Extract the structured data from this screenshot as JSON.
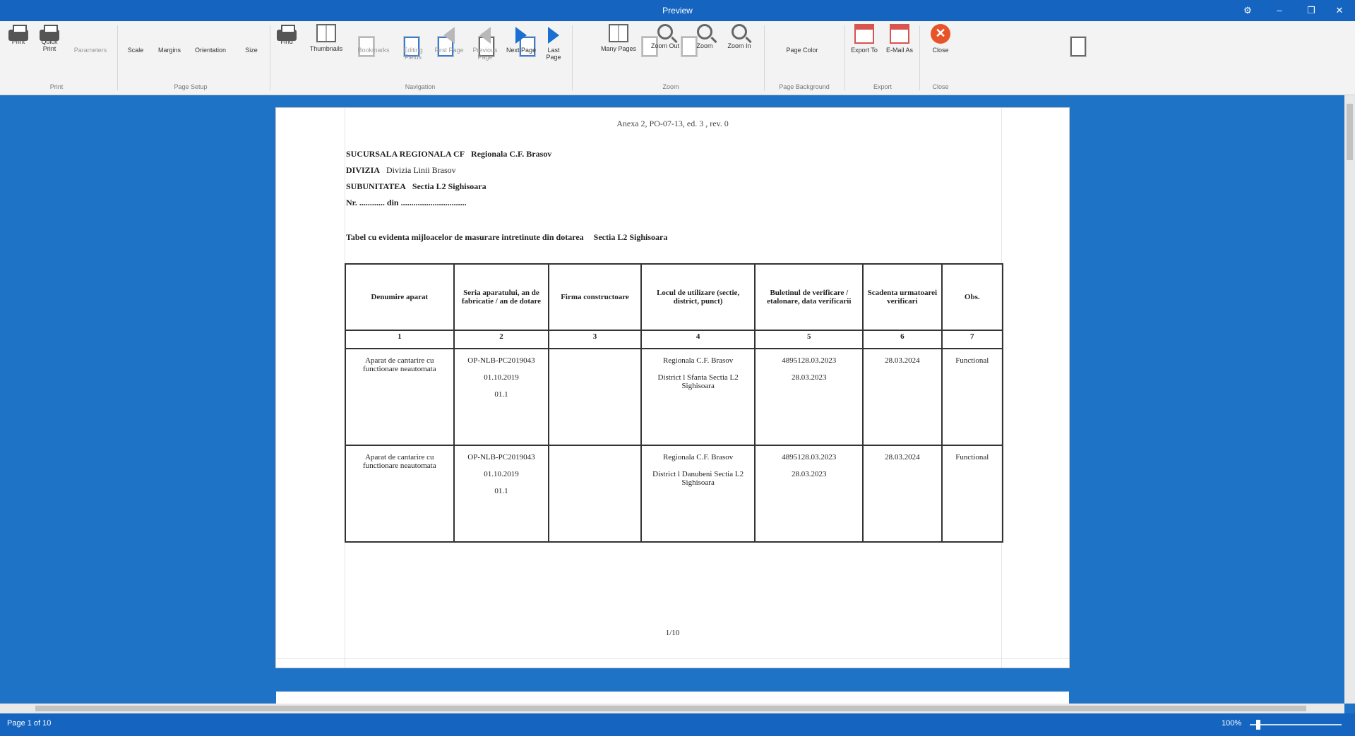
{
  "window": {
    "title": "Preview",
    "controls": [
      "⚙",
      "–",
      "❐",
      "✕"
    ]
  },
  "ribbon": {
    "tools": [
      {
        "id": "print",
        "label": "Print",
        "icon": "printer-icon"
      },
      {
        "id": "quick_print",
        "label": "Quick Print",
        "icon": "quick-print-icon"
      },
      {
        "id": "parameters",
        "label": "Parameters",
        "icon": "parameters-icon"
      },
      {
        "id": "scale",
        "label": "Scale",
        "icon": "scale-icon"
      },
      {
        "id": "margins",
        "label": "Margins",
        "icon": "margins-icon"
      },
      {
        "id": "orientation",
        "label": "Orientation",
        "icon": "orientation-icon"
      },
      {
        "id": "size",
        "label": "Size",
        "icon": "size-icon"
      },
      {
        "id": "find",
        "label": "Find",
        "icon": "find-icon"
      },
      {
        "id": "thumbnails",
        "label": "Thumbnails",
        "icon": "thumbnails-icon"
      },
      {
        "id": "bookmarks",
        "label": "Bookmarks",
        "icon": "bookmarks-icon"
      },
      {
        "id": "editing_fields",
        "label": "Editing Fields",
        "icon": "editing-fields-icon"
      },
      {
        "id": "first_page",
        "label": "First Page",
        "icon": "first-page-icon"
      },
      {
        "id": "previous_page",
        "label": "Previous Page",
        "icon": "previous-page-icon"
      },
      {
        "id": "next_page",
        "label": "Next Page",
        "icon": "next-page-icon"
      },
      {
        "id": "last_page",
        "label": "Last Page",
        "icon": "last-page-icon"
      },
      {
        "id": "many_pages",
        "label": "Many Pages",
        "icon": "many-pages-icon"
      },
      {
        "id": "zoom_out",
        "label": "Zoom Out",
        "icon": "zoom-out-icon"
      },
      {
        "id": "zoom",
        "label": "Zoom",
        "icon": "zoom-icon"
      },
      {
        "id": "zoom_in",
        "label": "Zoom In",
        "icon": "zoom-in-icon"
      },
      {
        "id": "page_color",
        "label": "Page Color",
        "icon": "page-color-icon"
      },
      {
        "id": "export_to",
        "label": "Export To",
        "icon": "export-icon"
      },
      {
        "id": "email_as",
        "label": "E-Mail As",
        "icon": "email-icon"
      },
      {
        "id": "close",
        "label": "Close",
        "icon": "close-icon"
      }
    ],
    "groups": [
      "Print",
      "Page Setup",
      "Navigation",
      "Zoom",
      "Page Background",
      "Export",
      "Close"
    ]
  },
  "document": {
    "header": "Anexa 2, PO-07-13, ed. 3 , rev. 0",
    "info": [
      {
        "label": "SUCURSALA REGIONALA CF",
        "value": "Regionala C.F. Brasov"
      },
      {
        "label": "DIVIZIA",
        "value": "Divizia Linii Brasov"
      },
      {
        "label": "SUBUNITATEA",
        "value": "Sectia L2 Sighisoara"
      },
      {
        "label": "Nr. ............ din ...............................",
        "value": ""
      }
    ],
    "title": "Tabel cu evidenta mijloacelor de masurare intretinute din dotarea",
    "title_value": "Sectia L2 Sighisoara",
    "columns": [
      "Denumire aparat",
      "Seria aparatului, an de fabricatie / an de dotare",
      "Firma constructoare",
      "Locul de utilizare (sectie, district, punct)",
      "Buletinul de verificare / etalonare, data verificarii",
      "Scadenta urmatoarei verificari",
      "Obs."
    ],
    "col_numbers": [
      "1",
      "2",
      "3",
      "4",
      "5",
      "6",
      "7"
    ],
    "rows": [
      {
        "c1": "Aparat de cantarire cu functionare neautomata",
        "c2": [
          "OP-NLB-PC2019043",
          "01.10.2019",
          "01.1"
        ],
        "c3": "",
        "c4": [
          "Regionala C.F. Brasov",
          "District l Sfanta Sectia L2 Sighisoara"
        ],
        "c5": [
          "4895128.03.2023",
          "28.03.2023"
        ],
        "c6": "28.03.2024",
        "c7": "Functional"
      },
      {
        "c1": "Aparat de cantarire cu functionare neautomata",
        "c2": [
          "OP-NLB-PC2019043",
          "01.10.2019",
          "01.1"
        ],
        "c3": "",
        "c4": [
          "Regionala C.F. Brasov",
          "District l Danubeni Sectia L2 Sighisoara"
        ],
        "c5": [
          "4895128.03.2023",
          "28.03.2023"
        ],
        "c6": "28.03.2024",
        "c7": "Functional"
      }
    ],
    "page_number": "1/10"
  },
  "status": {
    "page": "Page 1 of 10",
    "zoom": "100%"
  }
}
